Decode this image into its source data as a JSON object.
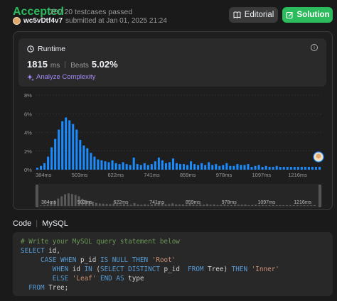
{
  "status": {
    "label": "Accepted",
    "testcases": "20 / 20 testcases passed"
  },
  "submission": {
    "username": "wc5vDtf4v7",
    "meta": "submitted at Jan 01, 2025 21:24"
  },
  "buttons": {
    "editorial": "Editorial",
    "solution": "Solution"
  },
  "runtime": {
    "title": "Runtime",
    "value": "1815",
    "unit": "ms",
    "beats_label": "Beats",
    "beats_value": "5.02%",
    "analyze": "Analyze Complexity"
  },
  "chart_data": {
    "type": "bar",
    "y_ticks": [
      "8%",
      "6%",
      "4%",
      "2%",
      "0%"
    ],
    "ylim": [
      0,
      8
    ],
    "x_ticks": [
      "384ms",
      "503ms",
      "622ms",
      "741ms",
      "859ms",
      "978ms",
      "1097ms",
      "1216ms"
    ],
    "values": [
      0.2,
      0.4,
      0.7,
      1.4,
      2.4,
      3.3,
      4.3,
      5.2,
      5.6,
      5.3,
      4.9,
      4.3,
      3.2,
      2.6,
      2.3,
      1.8,
      1.4,
      1.1,
      1.0,
      0.9,
      0.8,
      1.0,
      0.7,
      0.6,
      0.8,
      0.6,
      0.5,
      1.3,
      0.6,
      0.5,
      0.7,
      0.5,
      0.6,
      0.9,
      1.3,
      1.0,
      0.7,
      0.8,
      1.2,
      0.7,
      0.6,
      0.6,
      0.5,
      0.9,
      0.6,
      0.5,
      0.7,
      0.5,
      0.8,
      0.5,
      0.6,
      0.4,
      0.5,
      0.7,
      0.4,
      0.4,
      0.6,
      0.5,
      0.5,
      0.6,
      0.3,
      0.4,
      0.5,
      0.3,
      0.4,
      0.3,
      0.3,
      0.4,
      0.3,
      0.3,
      0.3,
      0.3,
      0.3,
      0.3,
      0.3,
      0.3,
      0.3,
      0.3,
      0.3,
      0.3
    ],
    "grid": true
  },
  "code_section": {
    "label": "Code",
    "language": "MySQL"
  },
  "code_lines": [
    [
      {
        "t": "comment",
        "v": "# Write your MySQL query statement below"
      }
    ],
    [
      {
        "t": "kw",
        "v": "SELECT"
      },
      {
        "t": "plain",
        "v": " id,"
      }
    ],
    [
      {
        "t": "plain",
        "v": "     "
      },
      {
        "t": "kw",
        "v": "CASE WHEN"
      },
      {
        "t": "plain",
        "v": " p_id "
      },
      {
        "t": "kw",
        "v": "IS NULL THEN"
      },
      {
        "t": "plain",
        "v": " "
      },
      {
        "t": "str",
        "v": "'Root'"
      }
    ],
    [
      {
        "t": "plain",
        "v": "        "
      },
      {
        "t": "kw",
        "v": "WHEN"
      },
      {
        "t": "plain",
        "v": " id "
      },
      {
        "t": "kw",
        "v": "IN"
      },
      {
        "t": "plain",
        "v": " ("
      },
      {
        "t": "kw",
        "v": "SELECT DISTINCT"
      },
      {
        "t": "plain",
        "v": " p_id  "
      },
      {
        "t": "kw",
        "v": "FROM"
      },
      {
        "t": "plain",
        "v": " Tree) "
      },
      {
        "t": "kw",
        "v": "THEN"
      },
      {
        "t": "plain",
        "v": " "
      },
      {
        "t": "str",
        "v": "'Inner'"
      }
    ],
    [
      {
        "t": "plain",
        "v": "        "
      },
      {
        "t": "kw",
        "v": "ELSE"
      },
      {
        "t": "plain",
        "v": " "
      },
      {
        "t": "str",
        "v": "'Leaf'"
      },
      {
        "t": "plain",
        "v": " "
      },
      {
        "t": "kw",
        "v": "END AS"
      },
      {
        "t": "plain",
        "v": " type"
      }
    ],
    [
      {
        "t": "plain",
        "v": "  "
      },
      {
        "t": "kw",
        "v": "FROM"
      },
      {
        "t": "plain",
        "v": " Tree;"
      }
    ]
  ],
  "colors": {
    "accent_green": "#2cbb5d",
    "bar_blue": "#1a8cff",
    "bar_dim": "#5a5a5a",
    "analyze_purple": "#a78bfa"
  }
}
